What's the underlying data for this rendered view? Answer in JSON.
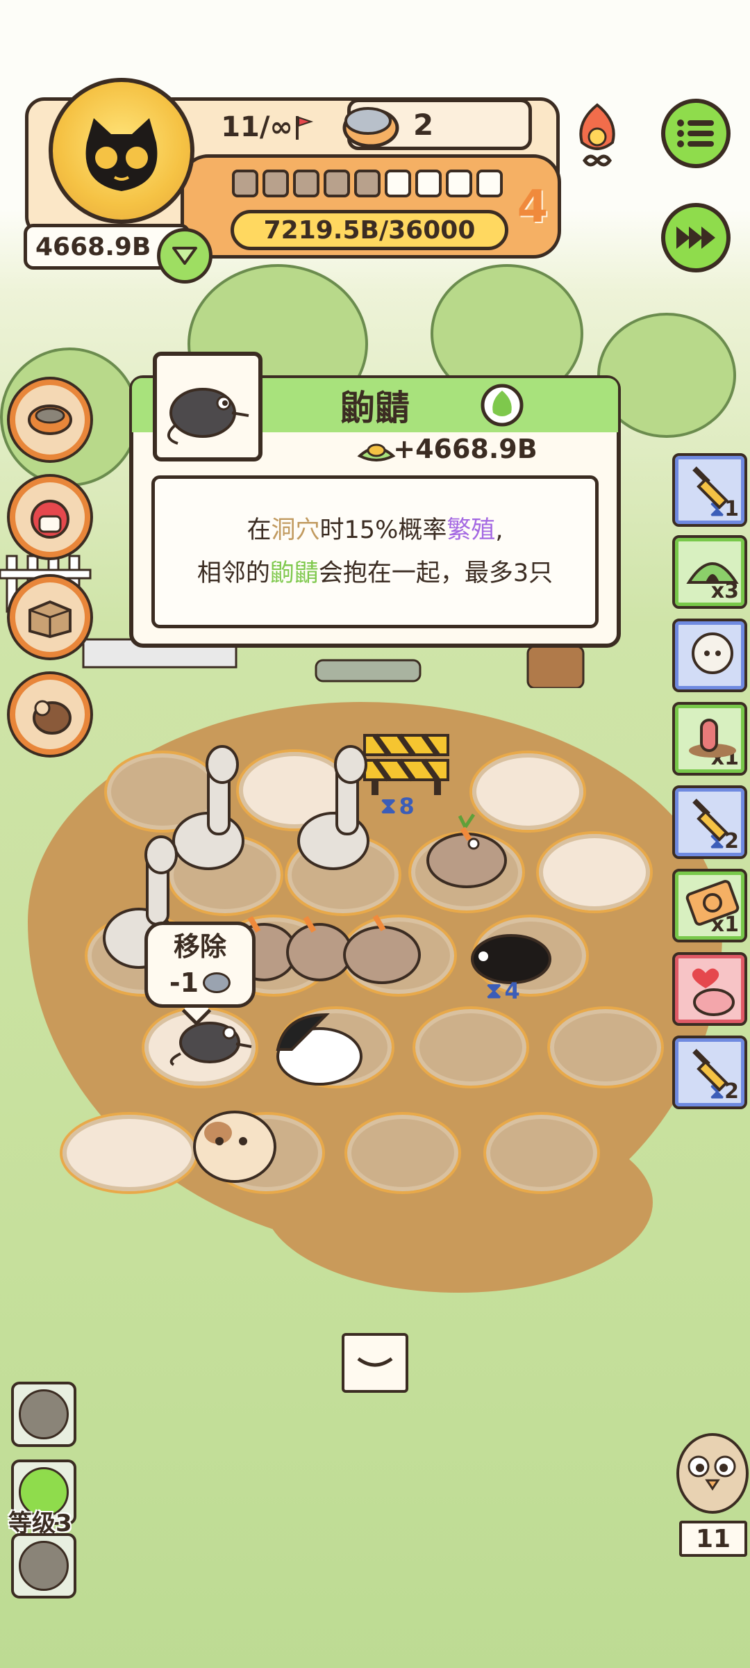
{
  "hud": {
    "level_text": "11/∞",
    "cans": "2",
    "money": "4668.9B",
    "exp_text": "7219.5B/36000",
    "stage": "4",
    "progress_segments_filled": 5,
    "progress_segments_total": 9
  },
  "popup": {
    "title": "鼩鼱",
    "income": "+4668.9B",
    "desc_line1_a": "在",
    "desc_line1_b": "洞穴",
    "desc_line1_c": "时15%概率",
    "desc_line1_d": "繁殖",
    "desc_line1_e": ",",
    "desc_line2_a": "相邻的",
    "desc_line2_b": "鼩鼱",
    "desc_line2_c": "会抱在一起，最多3只"
  },
  "board": {
    "timer_1": "8",
    "timer_2": "4",
    "remove_label": "移除",
    "remove_cost": "-1"
  },
  "right_panel": [
    {
      "icon": "shovel-icon",
      "badge": "1",
      "style": "blue"
    },
    {
      "icon": "tent-icon",
      "badge": "x3",
      "style": "green"
    },
    {
      "icon": "sheep-icon",
      "badge": "",
      "style": "blue"
    },
    {
      "icon": "worm-icon",
      "badge": "x1",
      "style": "green"
    },
    {
      "icon": "shovel-icon",
      "badge": "2",
      "style": "blue"
    },
    {
      "icon": "refresh-ticket-icon",
      "badge": "x1",
      "style": "green"
    },
    {
      "icon": "heart-creature-icon",
      "badge": "",
      "style": "red"
    },
    {
      "icon": "shovel-icon",
      "badge": "2",
      "style": "blue"
    }
  ],
  "bottom": {
    "level_label": "等级3",
    "creature_count": "11"
  },
  "colors": {
    "accent_green": "#8fdc4c",
    "hud_orange": "#f5b064",
    "highlight_purple": "#a468e2",
    "highlight_brown": "#c19a5f",
    "highlight_green": "#7ec84c"
  }
}
